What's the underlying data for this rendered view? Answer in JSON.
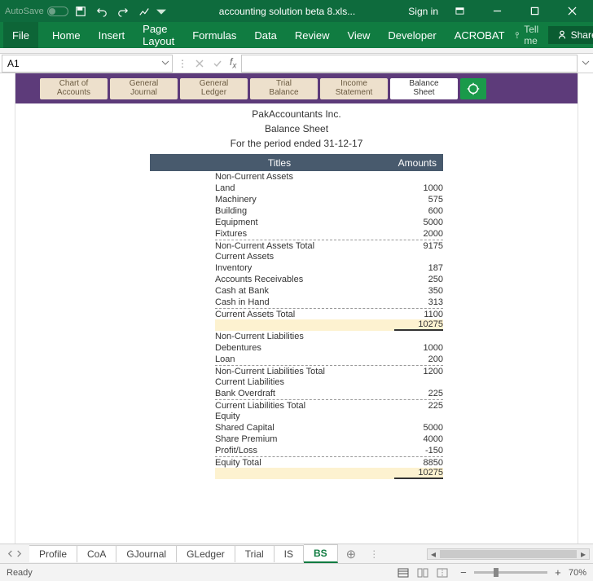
{
  "titlebar": {
    "autosave": "AutoSave",
    "filename": "accounting solution beta 8.xls...",
    "signin": "Sign in"
  },
  "ribbon": {
    "file": "File",
    "tabs": [
      "Home",
      "Insert",
      "Page Layout",
      "Formulas",
      "Data",
      "Review",
      "View",
      "Developer",
      "ACROBAT"
    ],
    "tellme": "Tell me",
    "share": "Share"
  },
  "fbar": {
    "cell": "A1"
  },
  "nav": {
    "items": [
      {
        "l1": "Chart of",
        "l2": "Accounts"
      },
      {
        "l1": "General",
        "l2": "Journal"
      },
      {
        "l1": "General",
        "l2": "Ledger"
      },
      {
        "l1": "Trial",
        "l2": "Balance"
      },
      {
        "l1": "Income",
        "l2": "Statement"
      },
      {
        "l1": "Balance",
        "l2": "Sheet"
      }
    ],
    "active": 5
  },
  "report": {
    "company": "PakAccountants Inc.",
    "title": "Balance Sheet",
    "period": "For the period ended 31-12-17",
    "head_titles": "Titles",
    "head_amounts": "Amounts"
  },
  "bs": {
    "rows": [
      {
        "type": "section",
        "t": "Non-Current Assets",
        "a": ""
      },
      {
        "type": "item",
        "t": "Land",
        "a": "1000"
      },
      {
        "type": "item",
        "t": "Machinery",
        "a": "575"
      },
      {
        "type": "item",
        "t": "Building",
        "a": "600"
      },
      {
        "type": "item",
        "t": "Equipment",
        "a": "5000"
      },
      {
        "type": "item",
        "t": "Fixtures",
        "a": "2000"
      },
      {
        "type": "total",
        "t": "Non-Current Assets Total",
        "a": "9175"
      },
      {
        "type": "section",
        "t": "Current Assets",
        "a": ""
      },
      {
        "type": "item",
        "t": "Inventory",
        "a": "187"
      },
      {
        "type": "item",
        "t": "Accounts Receivables",
        "a": "250"
      },
      {
        "type": "item",
        "t": "Cash at Bank",
        "a": "350"
      },
      {
        "type": "item",
        "t": "Cash in Hand",
        "a": "313"
      },
      {
        "type": "total",
        "t": "Current Assets Total",
        "a": "1100"
      },
      {
        "type": "hilite",
        "t": "",
        "a": "10275"
      },
      {
        "type": "section",
        "t": "Non-Current Liabilities",
        "a": ""
      },
      {
        "type": "item",
        "t": "Debentures",
        "a": "1000"
      },
      {
        "type": "item",
        "t": "Loan",
        "a": "200"
      },
      {
        "type": "total",
        "t": "Non-Current Liabilities Total",
        "a": "1200"
      },
      {
        "type": "section",
        "t": "Current Liabilities",
        "a": ""
      },
      {
        "type": "item",
        "t": "Bank Overdraft",
        "a": "225"
      },
      {
        "type": "total",
        "t": "Current Liabilities Total",
        "a": "225"
      },
      {
        "type": "section",
        "t": "Equity",
        "a": ""
      },
      {
        "type": "item",
        "t": "Shared Capital",
        "a": "5000"
      },
      {
        "type": "item",
        "t": "Share Premium",
        "a": "4000"
      },
      {
        "type": "item",
        "t": "Profit/Loss",
        "a": "-150"
      },
      {
        "type": "total",
        "t": "Equity Total",
        "a": "8850"
      },
      {
        "type": "hilite",
        "t": "",
        "a": "10275"
      }
    ]
  },
  "sheets": {
    "tabs": [
      "Profile",
      "CoA",
      "GJournal",
      "GLedger",
      "Trial",
      "IS",
      "BS"
    ],
    "active": 6
  },
  "status": {
    "ready": "Ready",
    "zoom": "70%"
  }
}
